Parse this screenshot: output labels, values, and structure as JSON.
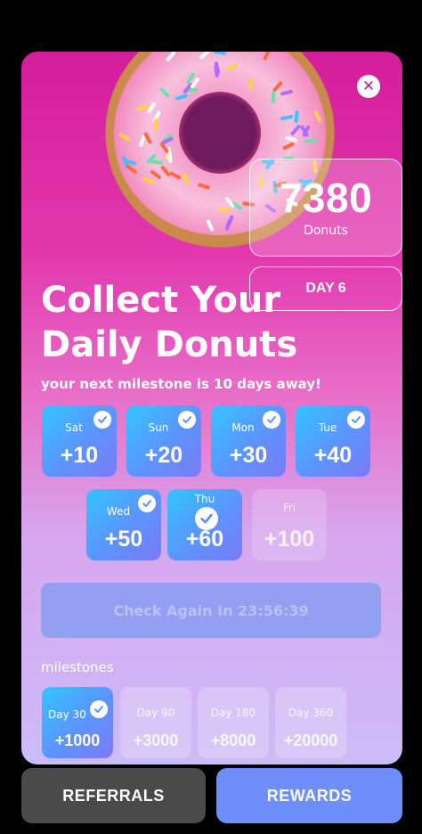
{
  "header": {
    "close_icon": "close-icon",
    "score_value": "7380",
    "score_label": "Donuts",
    "day_label": "DAY 6"
  },
  "title_line1": "Collect Your",
  "title_line2": "Daily Donuts",
  "subtitle": "your next milestone is 10 days away!",
  "days": [
    {
      "day": "Sat",
      "reward": "+10",
      "claimed": true
    },
    {
      "day": "Sun",
      "reward": "+20",
      "claimed": true
    },
    {
      "day": "Mon",
      "reward": "+30",
      "claimed": true
    },
    {
      "day": "Tue",
      "reward": "+40",
      "claimed": true
    },
    {
      "day": "Wed",
      "reward": "+50",
      "claimed": true
    },
    {
      "day": "Thu",
      "reward": "+60",
      "claimed": true,
      "today": true
    },
    {
      "day": "Fri",
      "reward": "+100",
      "claimed": false
    }
  ],
  "check_button_label": "Check Again In 23:56:39",
  "milestones_label": "milestones",
  "milestones": [
    {
      "day": "Day 30",
      "reward": "+1000",
      "achieved": true
    },
    {
      "day": "Day 90",
      "reward": "+3000",
      "achieved": false
    },
    {
      "day": "Day 180",
      "reward": "+8000",
      "achieved": false
    },
    {
      "day": "Day 360",
      "reward": "+20000",
      "achieved": false
    }
  ],
  "footer": {
    "referrals_label": "REFERRALS",
    "rewards_label": "REWARDS"
  },
  "colors": {
    "accent_blue": "#5d93ff",
    "referrals_bg": "#4a4a4a",
    "rewards_bg": "#6e8ffb",
    "card_top": "#d41d9c",
    "card_bottom": "#cdbbf8"
  }
}
